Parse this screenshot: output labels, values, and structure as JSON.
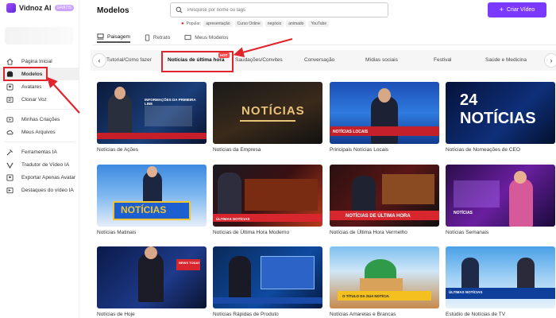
{
  "app": {
    "logo_text": "Vidnoz AI",
    "logo_badge": "GRÁTIS"
  },
  "sidebar": {
    "items": [
      {
        "label": "Página Inicial",
        "icon": "home-icon"
      },
      {
        "label": "Modelos",
        "icon": "templates-icon",
        "active": true
      },
      {
        "label": "Avatares",
        "icon": "avatar-icon"
      },
      {
        "label": "Clonar Voz",
        "icon": "voice-icon"
      },
      {
        "label": "Minhas Criações",
        "icon": "video-icon"
      },
      {
        "label": "Meus Arquivos",
        "icon": "cloud-icon"
      },
      {
        "label": "Ferramentas IA",
        "icon": "tools-icon"
      },
      {
        "label": "Tradutor de Vídeo IA",
        "icon": "translate-icon"
      },
      {
        "label": "Exportar Apenas Avatar",
        "icon": "export-icon"
      },
      {
        "label": "Destaques do vídeo IA",
        "icon": "highlight-icon"
      }
    ]
  },
  "header": {
    "title": "Modelos",
    "search_placeholder": "Pesquise por nome ou tags",
    "popular_label": "Popular:",
    "popular_tags": [
      "apresentação",
      "Curso Online",
      "negócio",
      "animado",
      "YouTube"
    ],
    "create_button": "Criar Vídeo"
  },
  "view_tabs": [
    {
      "label": "Paisagem",
      "active": true
    },
    {
      "label": "Retrato",
      "active": false
    },
    {
      "label": "Meus Modelos",
      "active": false
    }
  ],
  "categories": [
    {
      "label": "Tutorial/Como fazer"
    },
    {
      "label": "Notícias de última hora",
      "active": true,
      "badge": "HOT"
    },
    {
      "label": "Saudações/Convites"
    },
    {
      "label": "Conversação"
    },
    {
      "label": "Mídias sociais"
    },
    {
      "label": "Festival"
    },
    {
      "label": "Saúde e Medicina"
    }
  ],
  "templates": [
    {
      "title": "Notícias de Ações",
      "thumb_text": "INFORMAÇÕES DA PRIMEIRA LINE"
    },
    {
      "title": "Notícias da Empresa",
      "thumb_text": "NOTÍCIAS"
    },
    {
      "title": "Principais Notícias Locais",
      "thumb_text": "NOTÍCIAS LOCAIS"
    },
    {
      "title": "Notícias de Nomeações de CEO",
      "thumb_text": "24 NOTÍCIAS"
    },
    {
      "title": "Notícias Matinais",
      "thumb_text": "NOTÍCIAS"
    },
    {
      "title": "Notícias de Última Hora Moderno",
      "thumb_text": "ÚLTIMAS NOTÍCIAS"
    },
    {
      "title": "Notícias de Última Hora Vermelho",
      "thumb_text": "NOTÍCIAS DE ÚLTIMA HORA"
    },
    {
      "title": "Notícias Semanais",
      "thumb_text": "NOTÍCIAS"
    },
    {
      "title": "Notícias de Hoje",
      "thumb_text": "NEWS TODAY"
    },
    {
      "title": "Notícias Rápidas de Produto",
      "thumb_text": ""
    },
    {
      "title": "Notícias Amarelas e Brancas",
      "thumb_text": "O TÍTULO DA SUA NOTÍCIA"
    },
    {
      "title": "Estúdio de Notícias de TV",
      "thumb_text": "ÚLTIMAS NOTÍCIAS"
    }
  ],
  "colors": {
    "accent": "#7b39ff",
    "annotation_red": "#e0242b"
  }
}
